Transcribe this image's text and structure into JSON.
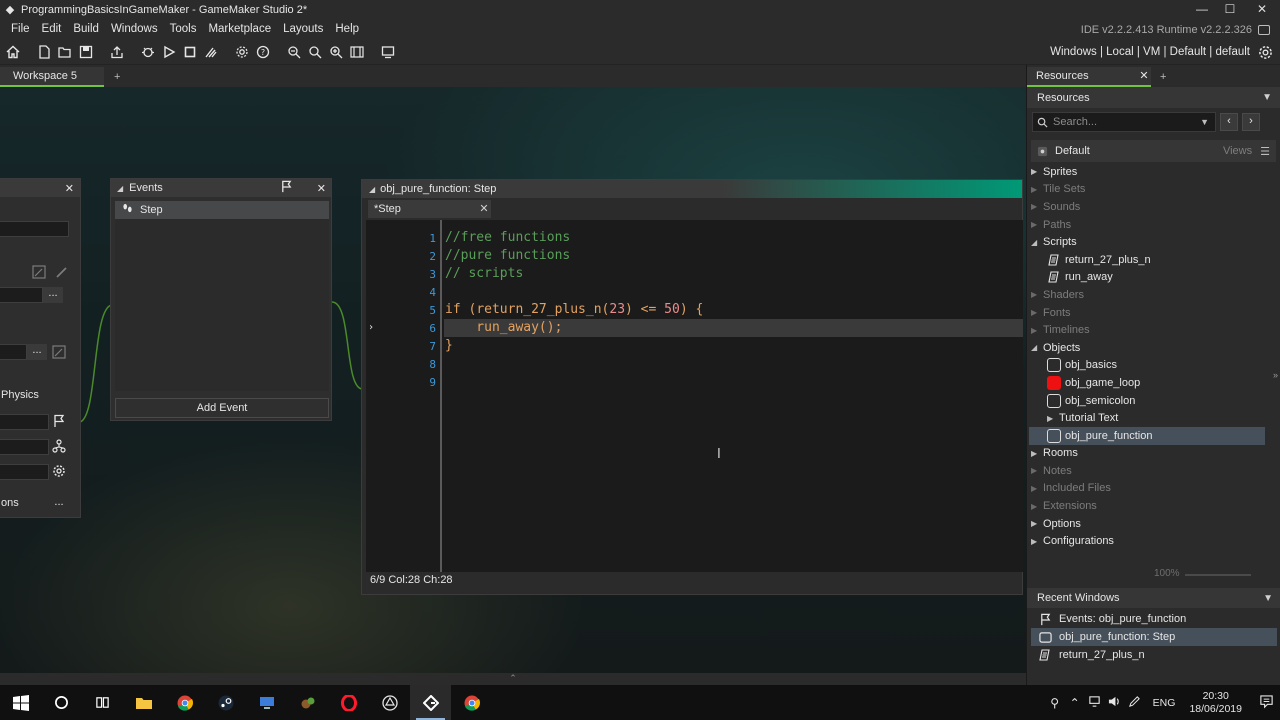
{
  "window": {
    "title": "ProgrammingBasicsInGameMaker - GameMaker Studio 2*",
    "minimize": "—",
    "maximize": "☐",
    "close": "✕"
  },
  "menu": {
    "items": [
      "File",
      "Edit",
      "Build",
      "Windows",
      "Tools",
      "Marketplace",
      "Layouts",
      "Help"
    ],
    "ide_version": "IDE v2.2.2.413  Runtime v2.2.2.326"
  },
  "toolbar": {
    "target": "Windows | Local | VM | Default | default"
  },
  "workspace": {
    "tab_label": "Workspace 5",
    "add_label": "+"
  },
  "object_panel": {
    "physics_label": "Physics",
    "options_label": "ons",
    "dots": "..."
  },
  "events_panel": {
    "title": "Events",
    "events": [
      {
        "label": "Step"
      }
    ],
    "add_event_label": "Add Event"
  },
  "code_window": {
    "title": "obj_pure_function: Step",
    "tab_label": "*Step",
    "line_numbers": [
      "1",
      "2",
      "3",
      "4",
      "5",
      "6",
      "7",
      "8",
      "9"
    ],
    "code": {
      "l2": "//free functions",
      "l3": "//pure functions",
      "l4": "// scripts",
      "l6_if": "if",
      "l6_open": " (",
      "l6_fn": "return_27_plus_n",
      "l6_paren": "(",
      "l6_arg": "23",
      "l6_rest": ") <=",
      "l6_num": " 50",
      "l6_end": ") {",
      "l7": "    run_away();",
      "l8": "}"
    },
    "status": "6/9 Col:28 Ch:28"
  },
  "resources": {
    "tab_label": "Resources",
    "header": "Resources",
    "search_placeholder": "Search...",
    "default_label": "Default",
    "views_label": "Views",
    "tree": {
      "sprites": "Sprites",
      "tile_sets": "Tile Sets",
      "sounds": "Sounds",
      "paths": "Paths",
      "scripts": "Scripts",
      "script_items": [
        "return_27_plus_n",
        "run_away"
      ],
      "shaders": "Shaders",
      "fonts": "Fonts",
      "timelines": "Timelines",
      "objects": "Objects",
      "object_items": [
        "obj_basics",
        "obj_game_loop",
        "obj_semicolon"
      ],
      "tutorial_text": "Tutorial Text",
      "selected_object": "obj_pure_function",
      "rooms": "Rooms",
      "notes": "Notes",
      "included_files": "Included Files",
      "extensions": "Extensions",
      "options": "Options",
      "configurations": "Configurations"
    },
    "zoom": "100%"
  },
  "recent_windows": {
    "header": "Recent Windows",
    "items": [
      "Events: obj_pure_function",
      "obj_pure_function: Step",
      "return_27_plus_n"
    ]
  },
  "taskbar": {
    "lang": "ENG",
    "time": "20:30",
    "date": "18/06/2019"
  },
  "colors": {
    "accent_green": "#71c340",
    "teal": "#009977",
    "object_red": "#ee1111"
  }
}
